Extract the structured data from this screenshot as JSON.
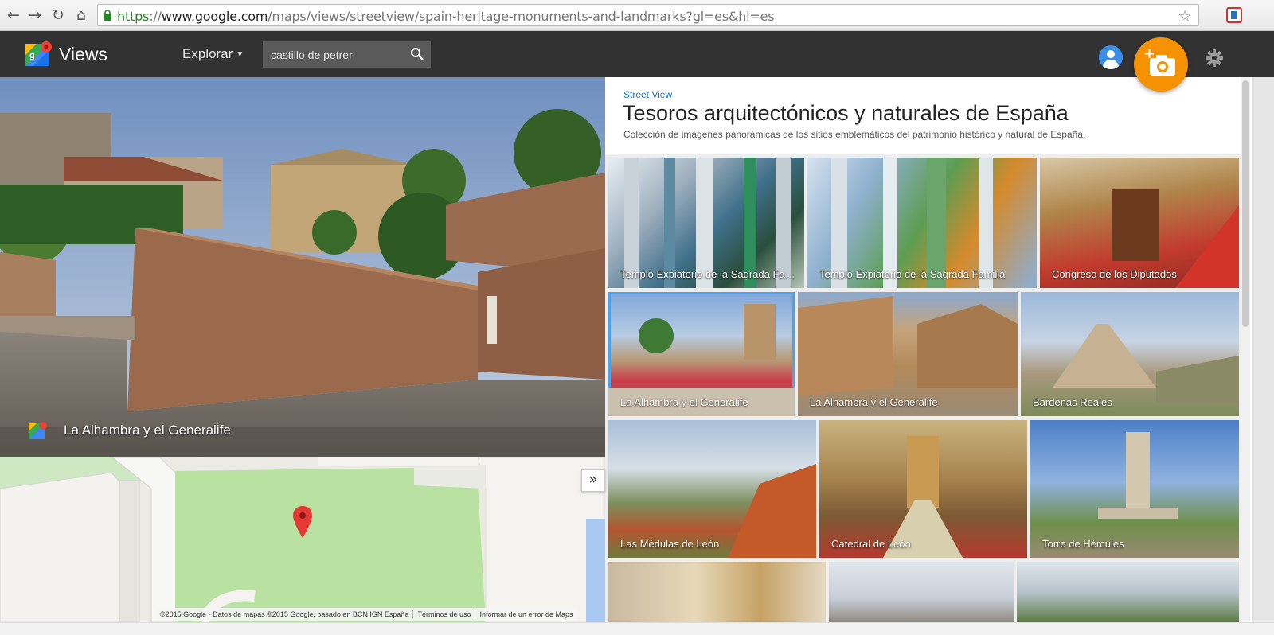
{
  "browser": {
    "url_scheme": "https",
    "url_sep": "://",
    "url_host": "www.google.com",
    "url_path": "/maps/views/streetview/spain-heritage-monuments-and-landmarks?gl=es&hl=es"
  },
  "header": {
    "app_name": "Views",
    "explore_label": "Explorar",
    "search_value": "castillo de petrer"
  },
  "streetview": {
    "location_label": "La Alhambra y el Generalife"
  },
  "map": {
    "copyright": "©2015 Google - Datos de mapas ©2015 Google, basado en BCN IGN España",
    "terms": "Términos de uso",
    "report": "Informar de un error de Maps"
  },
  "panel": {
    "eyebrow": "Street View",
    "title": "Tesoros arquitectónicos y naturales de España",
    "subtitle": "Colección de imágenes panorámicas de los sitios emblemáticos del patrimonio histórico y natural de España.",
    "tiles": [
      {
        "caption": "Templo Expiatorio de la Sagrada Familia"
      },
      {
        "caption": "Templo Expiatorio de la Sagrada Familia"
      },
      {
        "caption": "Congreso de los Diputados"
      },
      {
        "caption": "La Alhambra y el Generalife"
      },
      {
        "caption": "La Alhambra y el Generalife"
      },
      {
        "caption": "Bardenas Reales"
      },
      {
        "caption": "Las Médulas de León"
      },
      {
        "caption": "Catedral de León"
      },
      {
        "caption": "Torre de Hércules"
      },
      {
        "caption": ""
      },
      {
        "caption": ""
      },
      {
        "caption": ""
      }
    ]
  },
  "colors": {
    "appbar": "#323232",
    "fab": "#f69100",
    "accent": "#1a73c8",
    "selected_outline": "#4aa3f0"
  },
  "icons": [
    "back-icon",
    "forward-icon",
    "reload-icon",
    "home-icon",
    "lock-icon",
    "star-icon",
    "maps-logo-icon",
    "search-icon",
    "user-icon",
    "add-photo-icon",
    "gear-icon",
    "map-pin-icon",
    "collapse-icon"
  ]
}
